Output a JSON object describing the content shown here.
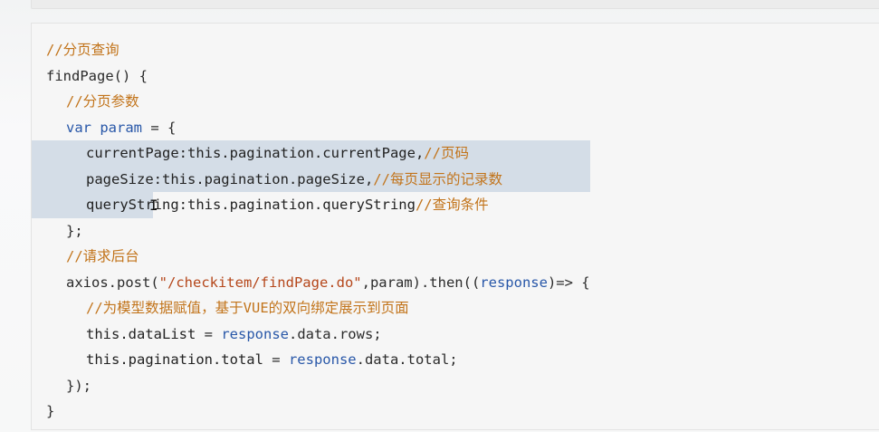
{
  "code_lines": [
    {
      "indent": 0,
      "selected": false,
      "tokens": [
        {
          "t": "//分页查询",
          "c": "comment"
        }
      ]
    },
    {
      "indent": 0,
      "selected": false,
      "tokens": [
        {
          "t": "findPage() {",
          "c": "punct"
        }
      ]
    },
    {
      "indent": 1,
      "selected": false,
      "tokens": [
        {
          "t": "//分页参数",
          "c": "comment"
        }
      ]
    },
    {
      "indent": 1,
      "selected": false,
      "tokens": [
        {
          "t": "var ",
          "c": "kw"
        },
        {
          "t": "param",
          "c": "var"
        },
        {
          "t": " = {",
          "c": "punct"
        }
      ]
    },
    {
      "indent": 2,
      "selected": true,
      "tokens": [
        {
          "t": "currentPage:this.pagination.currentPage,",
          "c": "prop"
        },
        {
          "t": "//页码",
          "c": "comment"
        }
      ]
    },
    {
      "indent": 2,
      "selected": true,
      "tokens": [
        {
          "t": "pageSize:this.pagination.pageSize,",
          "c": "prop"
        },
        {
          "t": "//每页显示的记录数",
          "c": "comment"
        }
      ]
    },
    {
      "indent": 2,
      "selected": "partial",
      "tokens": [
        {
          "t": "queryString:this.pagination.queryString",
          "c": "prop"
        },
        {
          "t": "//查询条件",
          "c": "comment"
        }
      ]
    },
    {
      "indent": 1,
      "selected": false,
      "tokens": [
        {
          "t": "};",
          "c": "punct"
        }
      ]
    },
    {
      "indent": 1,
      "selected": false,
      "tokens": [
        {
          "t": "//请求后台",
          "c": "comment"
        }
      ]
    },
    {
      "indent": 1,
      "selected": false,
      "tokens": [
        {
          "t": "axios.post(",
          "c": "punct"
        },
        {
          "t": "\"/checkitem/findPage.do\"",
          "c": "str"
        },
        {
          "t": ",param).then((",
          "c": "punct"
        },
        {
          "t": "response",
          "c": "var"
        },
        {
          "t": ")=> {",
          "c": "punct"
        }
      ]
    },
    {
      "indent": 2,
      "selected": false,
      "tokens": [
        {
          "t": "//为模型数据赋值，基于VUE的双向绑定展示到页面",
          "c": "comment"
        }
      ]
    },
    {
      "indent": 2,
      "selected": false,
      "tokens": [
        {
          "t": "this.dataList",
          "c": "prop"
        },
        {
          "t": " = ",
          "c": "punct"
        },
        {
          "t": "response",
          "c": "var"
        },
        {
          "t": ".data.rows;",
          "c": "punct"
        }
      ]
    },
    {
      "indent": 2,
      "selected": false,
      "tokens": [
        {
          "t": "this.pagination.total",
          "c": "prop"
        },
        {
          "t": " = ",
          "c": "punct"
        },
        {
          "t": "response",
          "c": "var"
        },
        {
          "t": ".data.total;",
          "c": "punct"
        }
      ]
    },
    {
      "indent": 1,
      "selected": false,
      "tokens": [
        {
          "t": "});",
          "c": "punct"
        }
      ]
    },
    {
      "indent": 0,
      "selected": false,
      "tokens": [
        {
          "t": "}",
          "c": "punct"
        }
      ]
    }
  ],
  "cursor": {
    "glyph": "I"
  }
}
